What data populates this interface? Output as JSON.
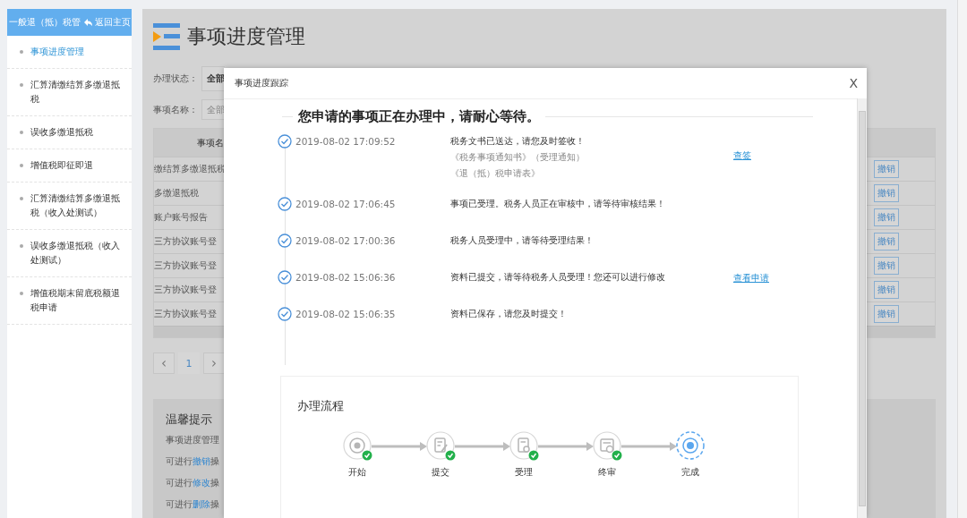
{
  "sidebar": {
    "header": {
      "title": "一般退（抵）税管",
      "back_link": "返回主页"
    },
    "items": [
      {
        "label": "事项进度管理",
        "selected": true
      },
      {
        "label": "汇算清缴结算多缴退抵税",
        "selected": false
      },
      {
        "label": "误收多缴退抵税",
        "selected": false
      },
      {
        "label": "增值税即征即退",
        "selected": false
      },
      {
        "label": "汇算清缴结算多缴退抵税（收入处测试）",
        "selected": false
      },
      {
        "label": "误收多缴退抵税（收入处测试）",
        "selected": false
      },
      {
        "label": "增值税期末留底税额退税申请",
        "selected": false
      }
    ]
  },
  "page": {
    "title": "事项进度管理",
    "filters": [
      {
        "label": "办理状态：",
        "value": "全部"
      },
      {
        "label": "事项名称：",
        "placeholder": "全部"
      }
    ],
    "table": {
      "columns": [
        "事项名"
      ],
      "rows": [
        {
          "name": "缴结算多缴退抵税",
          "action": "撤销"
        },
        {
          "name": "多缴退抵税",
          "action": "撤销"
        },
        {
          "name": "账户账号报告",
          "action": "撤销"
        },
        {
          "name": "三方协议账号登",
          "action": "撤销"
        },
        {
          "name": "三方协议账号登",
          "action": "撤销"
        },
        {
          "name": "三方协议账号登",
          "action": "撤销"
        },
        {
          "name": "三方协议账号登",
          "action": "撤销"
        }
      ]
    },
    "pagination": {
      "prev": "‹",
      "pages": [
        {
          "label": "1",
          "selected": true
        }
      ],
      "next": "›"
    },
    "tips": {
      "title": "温馨提示",
      "lines": [
        {
          "before": "事项进度管理"
        },
        {
          "before": "可进行",
          "link": "撤销",
          "after": "操"
        },
        {
          "before": "可进行",
          "link": "修改",
          "after": "操"
        },
        {
          "before": "可进行",
          "link": "删除",
          "after": "操"
        }
      ]
    }
  },
  "dialog": {
    "title": "事项进度跟踪",
    "close": "X",
    "heading": "您申请的事项正在办理中，请耐心等待。",
    "timeline": [
      {
        "time": "2019-08-02 17:09:52",
        "message": "税务文书已送达，请您及时签收！",
        "documents": [
          "《税务事项通知书》（受理通知）",
          "《退（抵）税申请表》"
        ],
        "link": "查签"
      },
      {
        "time": "2019-08-02 17:06:45",
        "message": "事项已受理。税务人员正在审核中，请等待审核结果！"
      },
      {
        "time": "2019-08-02 17:00:36",
        "message": "税务人员受理中，请等待受理结果！"
      },
      {
        "time": "2019-08-02 15:06:36",
        "message": "资料已提交，请等待税务人员受理！您还可以进行修改",
        "link": "查看申请"
      },
      {
        "time": "2019-08-02 15:06:35",
        "message": "资料已保存，请您及时提交！"
      }
    ],
    "flow": {
      "title": "办理流程",
      "steps": [
        {
          "label": "开始",
          "done": true
        },
        {
          "label": "提交",
          "done": true
        },
        {
          "label": "受理",
          "done": true
        },
        {
          "label": "终审",
          "done": true
        },
        {
          "label": "完成",
          "done": false
        }
      ]
    }
  }
}
